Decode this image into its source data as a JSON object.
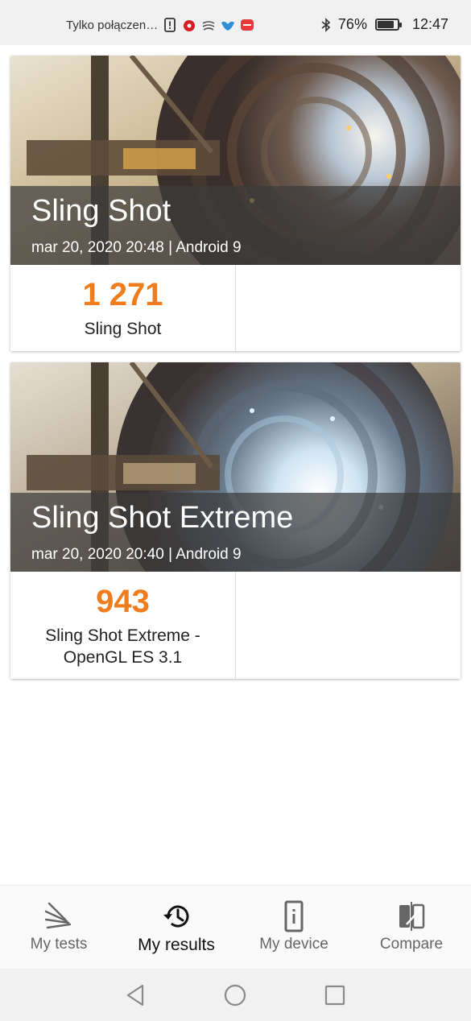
{
  "status_bar": {
    "carrier_text": "Tylko połączen…",
    "notification_icons": [
      "sim-alert-icon",
      "red-app-icon",
      "signal-waves-icon",
      "bird-app-icon",
      "red-badge-app-icon"
    ],
    "bluetooth_icon": "bluetooth-icon",
    "battery_percent": "76%",
    "battery_level": 0.76,
    "time": "12:47"
  },
  "cards": [
    {
      "title": "Sling Shot",
      "meta": "mar 20, 2020 20:48 | Android 9",
      "score": "1 271",
      "score_label": "Sling Shot"
    },
    {
      "title": "Sling Shot Extreme",
      "meta": "mar 20, 2020 20:40 | Android 9",
      "score": "943",
      "score_label": "Sling Shot Extreme - OpenGL ES 3.1"
    }
  ],
  "bottom_nav": {
    "items": [
      {
        "label": "My tests",
        "icon": "3dmark-logo-icon",
        "active": false
      },
      {
        "label": "My results",
        "icon": "history-icon",
        "active": true
      },
      {
        "label": "My device",
        "icon": "device-info-icon",
        "active": false
      },
      {
        "label": "Compare",
        "icon": "compare-icon",
        "active": false
      }
    ]
  },
  "system_nav": {
    "icons": [
      "back-icon",
      "home-icon",
      "recents-icon"
    ]
  },
  "colors": {
    "score": "#f07d1d",
    "overlay": "#3c3c3c",
    "status_bar": "#f1f1f1"
  }
}
